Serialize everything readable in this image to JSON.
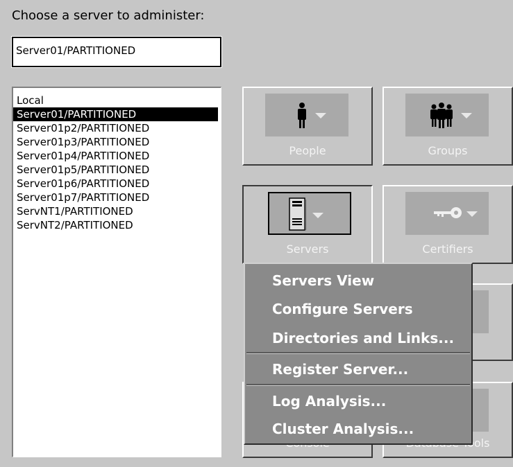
{
  "prompt": "Choose a server to administer:",
  "selected_server": "Server01/PARTITIONED",
  "server_list": [
    "Local",
    "Server01/PARTITIONED",
    "Server01p2/PARTITIONED",
    "Server01p3/PARTITIONED",
    "Server01p4/PARTITIONED",
    "Server01p5/PARTITIONED",
    "Server01p6/PARTITIONED",
    "Server01p7/PARTITIONED",
    "ServNT1/PARTITIONED",
    "ServNT2/PARTITIONED"
  ],
  "selected_index": 1,
  "tools": {
    "people": "People",
    "groups": "Groups",
    "servers": "Servers",
    "certifiers": "Certifiers",
    "console": "Console",
    "database_tools": "Database Tools"
  },
  "menu": {
    "servers_view": "Servers View",
    "configure_servers": "Configure Servers",
    "directories_links": "Directories and Links...",
    "register_server": "Register Server...",
    "log_analysis": "Log Analysis...",
    "cluster_analysis": "Cluster Analysis..."
  },
  "icons": {
    "people": "person-icon",
    "groups": "group-icon",
    "servers": "server-tower-icon",
    "certifiers": "key-icon"
  }
}
